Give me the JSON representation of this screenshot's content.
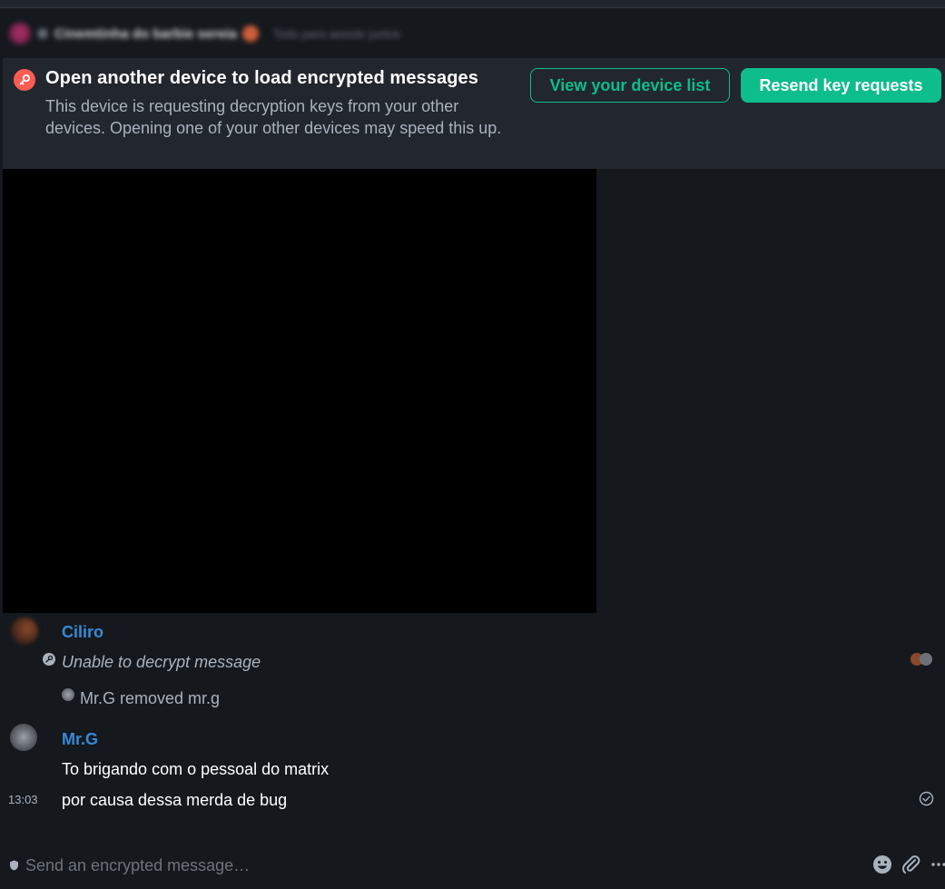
{
  "room_header": {
    "name": "Cinemtinha do barbie sereia",
    "topic": "Todo para assistir juntos"
  },
  "banner": {
    "title": "Open another device to load encrypted messages",
    "description": "This device is requesting decryption keys from your other devices. Opening one of your other devices may speed this up.",
    "view_devices_label": "View your device list",
    "resend_label": "Resend key requests"
  },
  "timeline": {
    "ciliro": {
      "sender": "Ciliro",
      "message": "Unable to decrypt message"
    },
    "state_event": "Mr.G removed mr.g",
    "mrg": {
      "sender": "Mr.G",
      "message1": "To brigando com o pessoal do matrix",
      "message2": "por causa dessa merda de bug",
      "timestamp": "13:03"
    }
  },
  "composer": {
    "placeholder": "Send an encrypted message…"
  },
  "colors": {
    "background": "#15191e",
    "banner": "#22272e",
    "accent": "#0dbd8b",
    "warning": "#ff5b55",
    "sender": "#368bd6",
    "muted": "#a9b2bc"
  }
}
